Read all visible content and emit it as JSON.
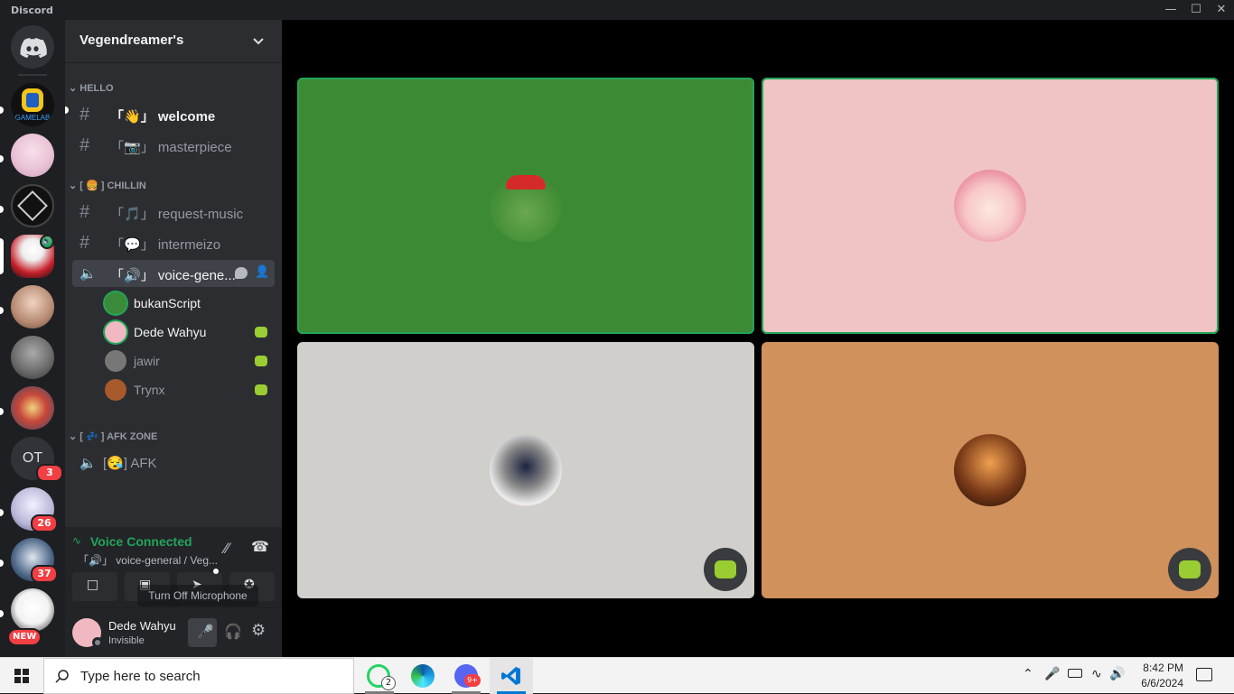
{
  "window": {
    "title": "Discord",
    "minimize_icon": "minimize-icon",
    "maximize_icon": "maximize-icon",
    "close_icon": "close-icon"
  },
  "guilds": {
    "items": [
      {
        "name": "home",
        "icon": "discord-logo-icon"
      },
      {
        "name": "GAMELAB",
        "label": "GAMELAB",
        "color": "#1f5fbf"
      },
      {
        "name": "anime-server",
        "color": "#e9c2d6"
      },
      {
        "name": "dark-emblem-server",
        "color": "#111111"
      },
      {
        "name": "voice-active-server",
        "color": "#c8202a"
      },
      {
        "name": "anime-girl-server",
        "color": "#b68a72"
      },
      {
        "name": "face-server",
        "color": "#6d6d6d"
      },
      {
        "name": "cartoon-server",
        "color": "#3a4a6b"
      },
      {
        "name": "OT",
        "label": "OT",
        "badge": "3"
      },
      {
        "name": "server-26",
        "badge": "26",
        "color": "#b8b6d8"
      },
      {
        "name": "server-37",
        "badge": "37",
        "color": "#4c6687"
      },
      {
        "name": "server-new",
        "badge": "NEW",
        "color": "#f2f2f2"
      }
    ]
  },
  "server": {
    "name": "Vegendreamer's",
    "dropdown_icon": "chevron-down-icon"
  },
  "categories": [
    {
      "label": "HELLO"
    },
    {
      "label": "[ 🍔 ] CHILLIN"
    },
    {
      "label": "[ 💤 ] AFK ZONE"
    }
  ],
  "channels": {
    "welcome": {
      "open": "「",
      "emoji": "👋",
      "close": "」",
      "name": "welcome"
    },
    "masterpiece": {
      "open": "「",
      "emoji": "📷",
      "close": "」",
      "name": "masterpiece"
    },
    "request_music": {
      "open": "「",
      "emoji": "🎵",
      "close": "」",
      "name": "request-music"
    },
    "intermeizo": {
      "open": "「",
      "emoji": "💬",
      "close": "」",
      "name": "intermeizo"
    },
    "voice_general": {
      "open": "「",
      "emoji": "🔊",
      "close": "」",
      "name": "voice-gene..."
    },
    "afk": {
      "open": "[",
      "emoji": "😪",
      "close": "]",
      "name": "AFK"
    }
  },
  "voice_members": [
    {
      "name": "bukanScript",
      "highlight": true,
      "avatar_color": "#3b8a3a"
    },
    {
      "name": "Dede Wahyu",
      "highlight": true,
      "avatar_color": "#f0b8c0",
      "activity_icon": "game-activity-icon"
    },
    {
      "name": "jawir",
      "highlight": false,
      "avatar_color": "#777777",
      "activity_icon": "game-activity-icon"
    },
    {
      "name": "Trynx",
      "highlight": false,
      "avatar_color": "#a85a2a",
      "activity_icon": "game-activity-icon"
    }
  ],
  "voice_panel": {
    "status": "Voice Connected",
    "channel": "「🔊」 voice-general / Veg...",
    "tooltip": "Turn Off Microphone"
  },
  "user_panel": {
    "name": "Dede Wahyu",
    "status": "Invisible"
  },
  "video_tiles": [
    {
      "name": "bukanScript",
      "bg": "#3d8a34",
      "speaking": true
    },
    {
      "name": "Dede Wahyu",
      "bg": "#f0c4c4",
      "speaking": true
    },
    {
      "name": "jawir",
      "bg": "#d0cfcb",
      "speaking": false,
      "activity": true
    },
    {
      "name": "Trynx",
      "bg": "#d0915c",
      "speaking": false,
      "activity": true
    }
  ],
  "taskbar": {
    "search_placeholder": "Type here to search",
    "apps": [
      {
        "name": "whatsapp",
        "badge": "2"
      },
      {
        "name": "edge"
      },
      {
        "name": "discord",
        "badge": "9+"
      },
      {
        "name": "vscode"
      }
    ],
    "time": "8:42 PM",
    "date": "6/6/2024"
  },
  "colors": {
    "accent_green": "#23a55a",
    "mention_red": "#f23f43",
    "discord_blurple": "#5865f2"
  }
}
